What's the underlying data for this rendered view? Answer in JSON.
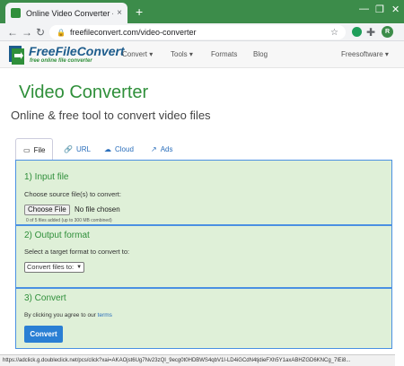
{
  "browser": {
    "tab_title": "Online Video Converter - FreeFile",
    "tab_close": "×",
    "new_tab": "+",
    "url": "freefileconvert.com/video-converter",
    "profile_initial": "R",
    "status_url": "https://adclick.g.doubleclick.net/pcs/click?xai=AKAOjst6Ug7Nv23zQI_9ecg0t0HDBWS4qbV1I-LD4iGCdN4tjdieFXh5Y1axABHZGD6KNCg_7lEi8...",
    "colors": {
      "chrome_green": "#3c8c4a",
      "accent": "#2f8f3a"
    }
  },
  "header": {
    "logo_name": "FreeFileConvert",
    "logo_tagline": "free online file converter",
    "menu": {
      "convert": "Convert ▾",
      "tools": "Tools ▾",
      "formats": "Formats",
      "blog": "Blog",
      "freesoftware": "Freesoftware ▾"
    }
  },
  "page": {
    "title": "Video Converter",
    "subtitle": "Online & free tool to convert video files"
  },
  "tabs": {
    "file": "File",
    "url": "URL",
    "cloud": "Cloud",
    "ads": "Ads"
  },
  "step1": {
    "heading": "1) Input file",
    "label": "Choose source file(s) to convert:",
    "choose_button": "Choose File",
    "no_file": "No file chosen",
    "note": "0  of  5  files added (up to 300 MB combined)"
  },
  "step2": {
    "heading": "2) Output format",
    "label": "Select a target format to convert to:",
    "select_value": "Convert files to:"
  },
  "step3": {
    "heading": "3) Convert",
    "agree_text": "By clicking you agree to our ",
    "terms_link": "terms",
    "convert_button": "Convert"
  }
}
